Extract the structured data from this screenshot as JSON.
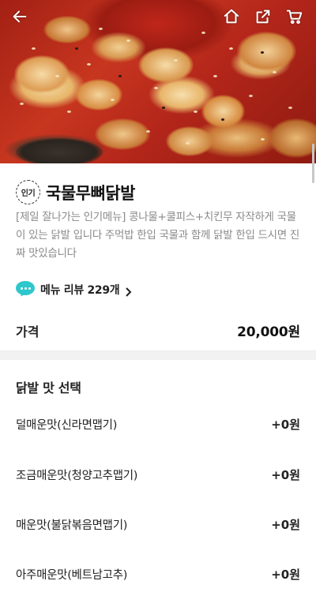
{
  "header": {
    "back_icon": "arrow-left-icon",
    "home_icon": "home-icon",
    "share_icon": "share-icon",
    "cart_icon": "cart-icon"
  },
  "menu": {
    "badge": "인기",
    "title": "국물무뼈닭발",
    "description": "[제일 잘나가는 인기메뉴] 콩나물+쿨피스+치킨무 자작하게 국물이 있는 닭발 입니다 주먹밥 한입 국물과 함께 닭발 한입 드시면 진짜 맛있습니다",
    "review_label": "메뉴 리뷰 229개"
  },
  "price": {
    "label": "가격",
    "value": "20,000원"
  },
  "options": {
    "title": "닭발 맛 선택",
    "items": [
      {
        "label": "덜매운맛(신라면맵기)",
        "price": "+0원"
      },
      {
        "label": "조금매운맛(청양고추맵기)",
        "price": "+0원"
      },
      {
        "label": "매운맛(불닭볶음면맵기)",
        "price": "+0원"
      },
      {
        "label": "아주매운맛(베트남고추)",
        "price": "+0원"
      }
    ]
  },
  "colors": {
    "review_icon": "#2ec7cc",
    "divider": "#f2f2f2"
  }
}
